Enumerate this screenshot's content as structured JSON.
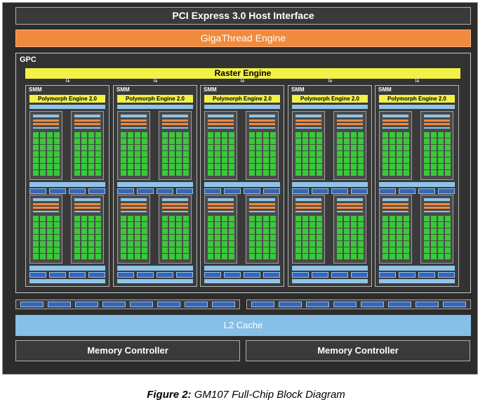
{
  "diagram": {
    "pcie_label": "PCI Express 3.0 Host Interface",
    "gigathread_label": "GigaThread Engine",
    "gpc_label": "GPC",
    "raster_label": "Raster Engine",
    "smm_label": "SMM",
    "polymorph_label": "Polymorph Engine 2.0",
    "l2_label": "L2 Cache",
    "memory_controllers": [
      "Memory Controller",
      "Memory Controller"
    ]
  },
  "caption": {
    "prefix": "Figure 2:",
    "text": " GM107 Full-Chip Block Diagram"
  },
  "colors": {
    "chip_background": "#2c2c2c",
    "gigathread": "#f08a3c",
    "raster": "#f2f246",
    "core": "#3ac93a",
    "l2": "#87bfe6",
    "ldst": "#3a64b8"
  }
}
